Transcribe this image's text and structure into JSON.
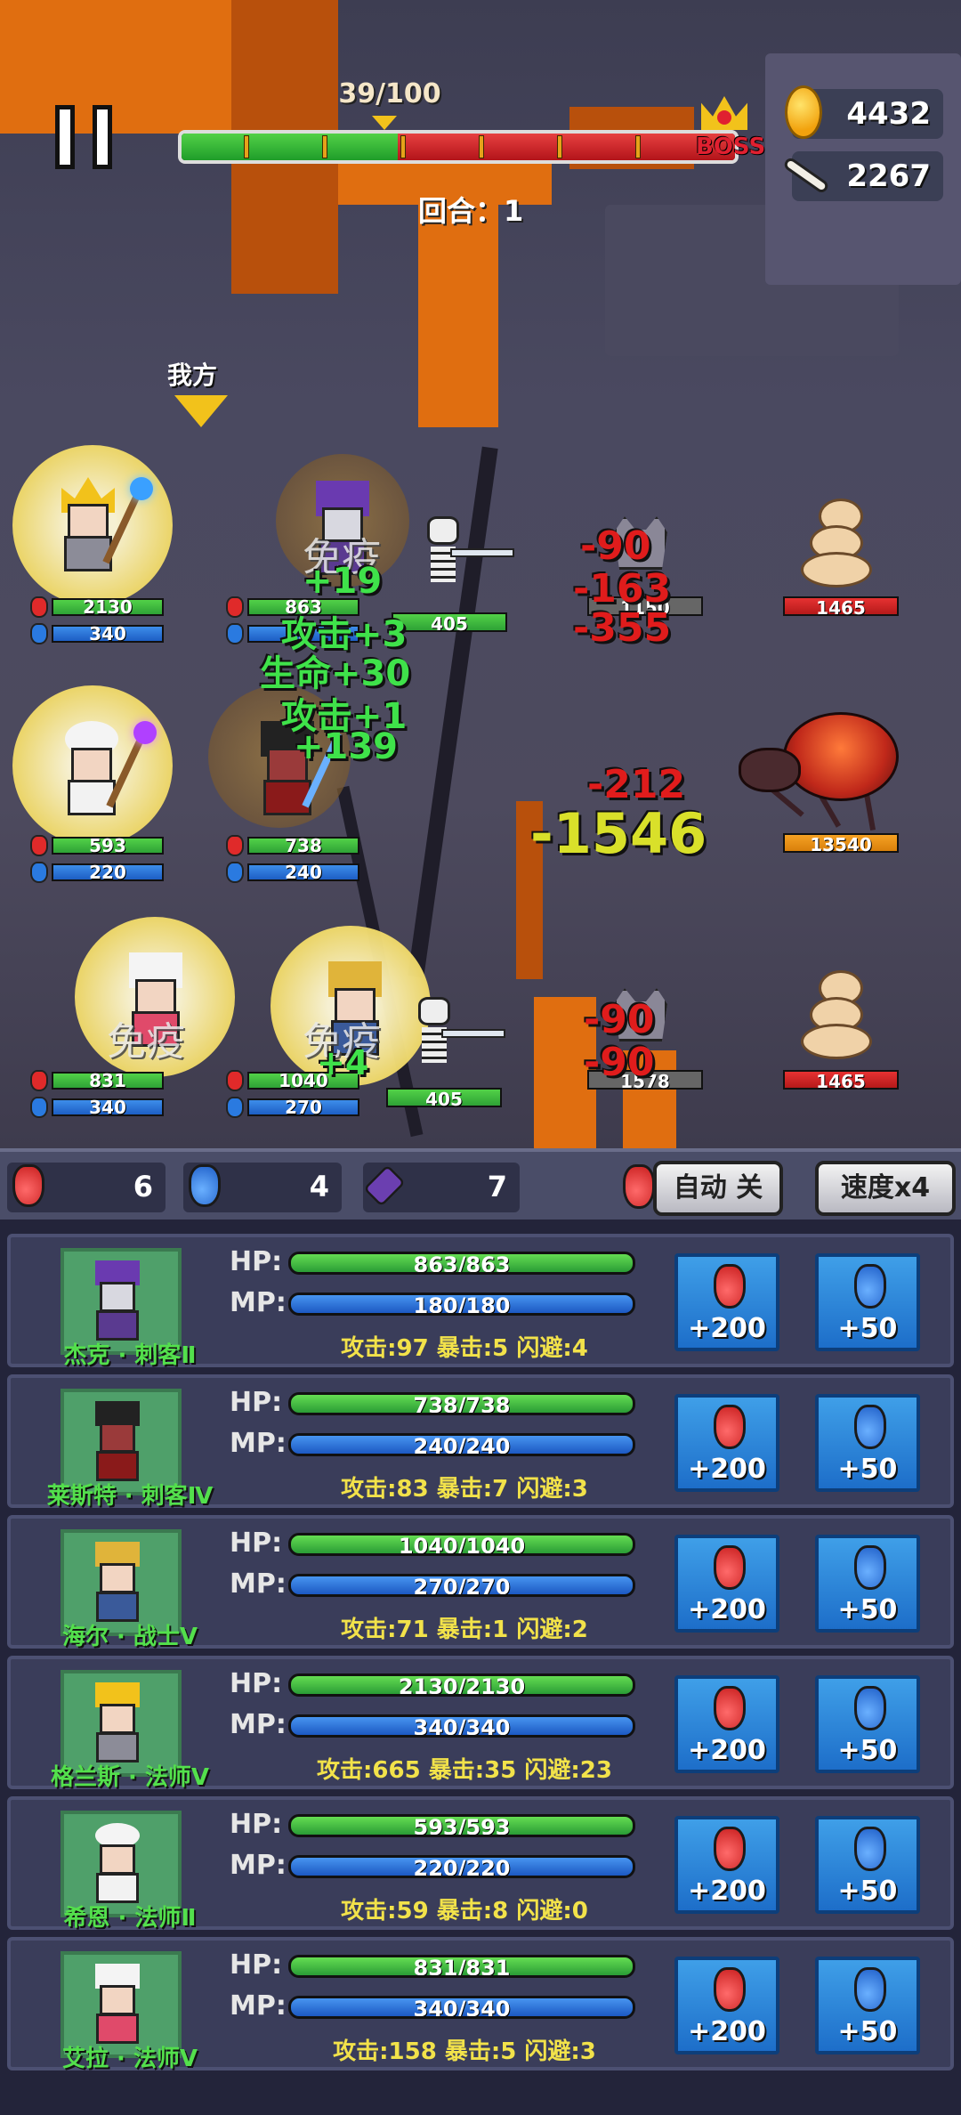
{
  "hud": {
    "wave": "39/100",
    "wave_progress": 0.39,
    "boss_label": "BOSS",
    "gold": "4432",
    "bones": "2267",
    "round": "回合：1",
    "our_side": "我方"
  },
  "allies": [
    {
      "hp": "2130",
      "mp": "340"
    },
    {
      "hp": "863",
      "mp": "1"
    },
    {
      "hp": "593",
      "mp": "220"
    },
    {
      "hp": "738",
      "mp": "240"
    },
    {
      "hp": "831",
      "mp": "340"
    },
    {
      "hp": "1040",
      "mp": "270"
    }
  ],
  "enemies": [
    {
      "name": "skeleton",
      "hp": "405"
    },
    {
      "name": "gargoyle",
      "hp": "1150"
    },
    {
      "name": "worm",
      "hp": "1465"
    },
    {
      "name": "spider",
      "hp": "13540"
    },
    {
      "name": "skeleton",
      "hp": "405"
    },
    {
      "name": "gargoyle",
      "hp": "1578"
    },
    {
      "name": "worm",
      "hp": "1465"
    }
  ],
  "floating_text": {
    "immune_1": "免疫",
    "heal_19": "+19",
    "atk_3": "攻击+3",
    "life_30": "生命+30",
    "atk_1": "攻击+1",
    "heal_139": "+139",
    "dmg_90_a": "-90",
    "dmg_163": "-163",
    "dmg_355": "-355",
    "dmg_212": "-212",
    "dmg_1546": "-1546",
    "immune_2": "免疫",
    "immune_3": "免疫",
    "heal_4": "+4",
    "dmg_90_b": "-90",
    "dmg_90_c": "-90"
  },
  "items": {
    "hp_potion_count": "6",
    "mp_potion_count": "4",
    "rune_count": "7",
    "auto_label": "自动 关",
    "speed_label": "速度x4"
  },
  "heroes": [
    {
      "name": "杰克 · 刺客Ⅱ",
      "hp": "863/863",
      "mp": "180/180",
      "stats": "攻击:97  暴击:5  闪避:4",
      "hp_btn": "+200",
      "mp_btn": "+50"
    },
    {
      "name": "莱斯特 · 刺客Ⅳ",
      "hp": "738/738",
      "mp": "240/240",
      "stats": "攻击:83  暴击:7  闪避:3",
      "hp_btn": "+200",
      "mp_btn": "+50"
    },
    {
      "name": "海尔 · 战士Ⅴ",
      "hp": "1040/1040",
      "mp": "270/270",
      "stats": "攻击:71  暴击:1  闪避:2",
      "hp_btn": "+200",
      "mp_btn": "+50"
    },
    {
      "name": "格兰斯 · 法师Ⅴ",
      "hp": "2130/2130",
      "mp": "340/340",
      "stats": "攻击:665  暴击:35  闪避:23",
      "hp_btn": "+200",
      "mp_btn": "+50"
    },
    {
      "name": "希恩 · 法师Ⅱ",
      "hp": "593/593",
      "mp": "220/220",
      "stats": "攻击:59  暴击:8  闪避:0",
      "hp_btn": "+200",
      "mp_btn": "+50"
    },
    {
      "name": "艾拉 · 法师Ⅴ",
      "hp": "831/831",
      "mp": "340/340",
      "stats": "攻击:158  暴击:5  闪避:3",
      "hp_btn": "+200",
      "mp_btn": "+50"
    }
  ],
  "colors": {
    "hp_green": "#2ea236",
    "mp_blue": "#1d5ec4",
    "damage_red": "#e01c1c",
    "heal_green": "#3fe24a",
    "gold": "#f2c21b",
    "panel_bg": "#3a3d5a"
  }
}
